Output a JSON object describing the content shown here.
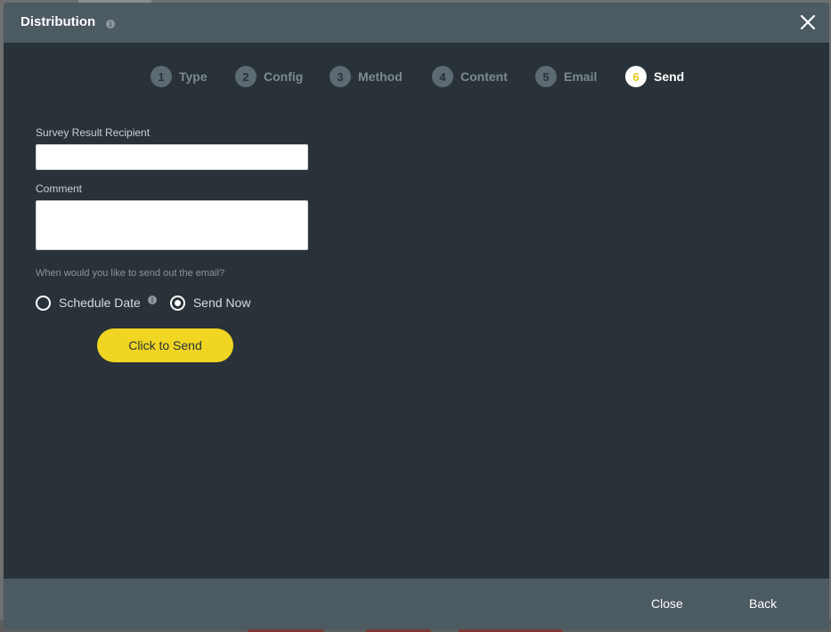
{
  "modal": {
    "title": "Distribution",
    "close_icon": "close-x-icon",
    "info_icon": "info-icon",
    "info_glyph": "i"
  },
  "steps": [
    {
      "number": "1",
      "label": "Type",
      "active": false
    },
    {
      "number": "2",
      "label": "Config",
      "active": false
    },
    {
      "number": "3",
      "label": "Method",
      "active": false
    },
    {
      "number": "4",
      "label": "Content",
      "active": false
    },
    {
      "number": "5",
      "label": "Email",
      "active": false
    },
    {
      "number": "6",
      "label": "Send",
      "active": true
    }
  ],
  "form": {
    "recipient_label": "Survey Result Recipient",
    "recipient_value": "",
    "comment_label": "Comment",
    "comment_value": "",
    "question": "When would you like to send out the email?",
    "options": [
      {
        "label": "Schedule Date",
        "selected": false
      },
      {
        "label": "Send Now",
        "selected": true
      }
    ],
    "send_label": "Click to Send"
  },
  "footer": {
    "close_label": "Close",
    "back_label": "Back"
  },
  "colors": {
    "modal_bg": "#283238",
    "header_bg": "#4c5a62",
    "accent_yellow": "#f0d523",
    "active_step_number": "#e8c91a"
  }
}
